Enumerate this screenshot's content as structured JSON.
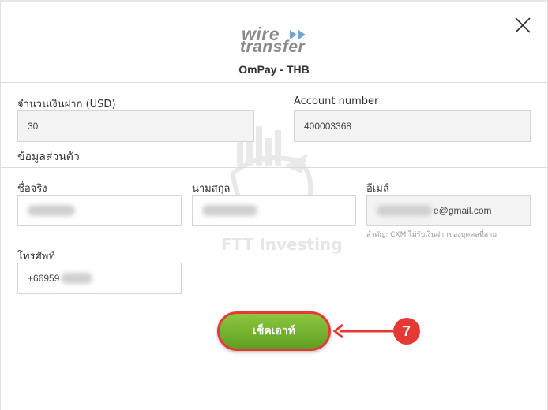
{
  "header": {
    "logo_line1": "wire",
    "logo_line2": "transfer",
    "method_title": "OmPay - THB"
  },
  "deposit": {
    "amount_label": "จำนวนเงินฝาก (USD)",
    "amount_value": "30",
    "account_label": "Account number",
    "account_value": "400003368"
  },
  "personal": {
    "section_title": "ข้อมูลส่วนตัว",
    "first_name_label": "ชื่อจริง",
    "last_name_label": "นามสกุล",
    "email_label": "อีเมล์",
    "email_value_suffix": "e@gmail.com",
    "email_note": "สำคัญ: CXM ไม่รับเงินฝากของบุคคลที่สาม",
    "phone_label": "โทรศัพท์",
    "phone_value": "+66959"
  },
  "watermark": {
    "text": "FTT Investing"
  },
  "checkout": {
    "label": "เช็คเอาท์"
  },
  "annotation": {
    "step_number": "7",
    "color": "#e53935"
  },
  "colors": {
    "button_green": "#6aab2a",
    "highlight_red": "#e53935"
  }
}
